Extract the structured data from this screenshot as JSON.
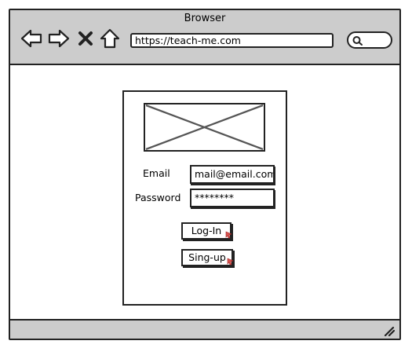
{
  "browser": {
    "title": "Browser",
    "url": "https://teach-me.com"
  },
  "login_form": {
    "email_label": "Email",
    "email_value": "mail@email.com",
    "password_label": "Password",
    "password_value": "********",
    "login_button": "Log-In",
    "signup_button": "Sing-up"
  }
}
